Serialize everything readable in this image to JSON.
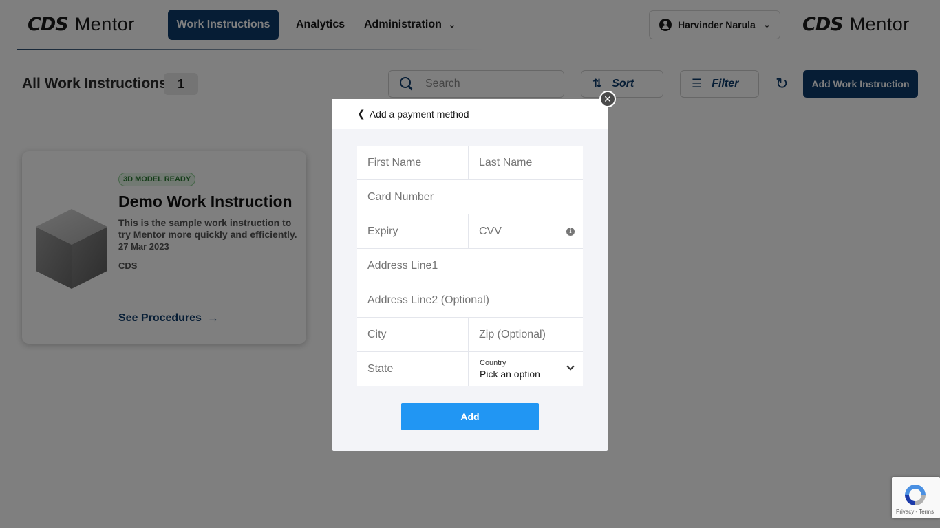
{
  "header": {
    "logo_mark": "CDS",
    "logo_word": "Mentor",
    "nav": {
      "work_instructions": "Work Instructions",
      "analytics": "Analytics",
      "administration": "Administration"
    },
    "user_name": "Harvinder Narula"
  },
  "toolbar": {
    "title": "All Work Instructions",
    "count": "1",
    "search_placeholder": "Search",
    "sort_label": "Sort",
    "filter_label": "Filter",
    "add_label": "Add Work Instruction"
  },
  "card": {
    "badge": "3D MODEL READY",
    "title": "Demo Work Instruction",
    "description": "This is the sample work instruction to try Mentor more quickly and efficiently.",
    "date": "27 Mar 2023",
    "owner": "CDS",
    "link_label": "See Procedures"
  },
  "modal": {
    "title": "Add a payment method",
    "close_glyph": "✕",
    "fields": {
      "first_name": "First Name",
      "last_name": "Last Name",
      "card_number": "Card Number",
      "expiry": "Expiry",
      "cvv": "CVV",
      "address1": "Address Line1",
      "address2": "Address Line2 (Optional)",
      "city": "City",
      "zip": "Zip (Optional)",
      "state": "State",
      "country_label": "Country",
      "country_value": "Pick an option"
    },
    "add_button": "Add"
  },
  "recaptcha": {
    "text": "Privacy - Terms"
  },
  "colors": {
    "primary": "#0d3a6a",
    "add_button": "#2196f3",
    "badge_green": "#2c7a34"
  },
  "icons": [
    "user-icon",
    "chevron-down-icon",
    "search-icon",
    "sort-icon",
    "filter-icon",
    "refresh-icon",
    "cube-icon",
    "arrow-right-icon",
    "chevron-left-icon",
    "close-icon",
    "info-icon",
    "recaptcha-icon"
  ]
}
